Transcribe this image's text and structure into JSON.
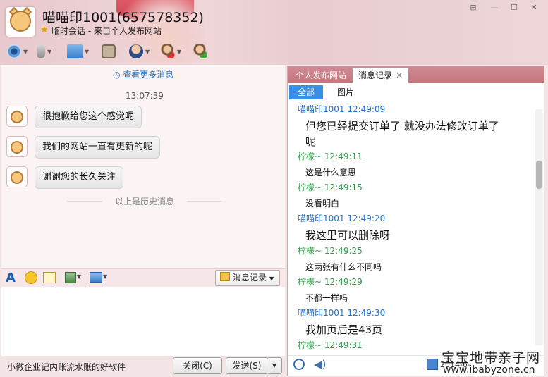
{
  "window": {
    "title": "喵喵印1001(657578352)",
    "subtitle": "临时会话 - 来自个人发布网站",
    "controls": [
      "⊟",
      "—",
      "☐",
      "✕"
    ]
  },
  "toolbar": {
    "icons": [
      "camera-icon",
      "microphone-icon",
      "file-transfer-icon",
      "screen-share-icon",
      "user-avatar-icon",
      "remove-user-icon",
      "add-user-icon"
    ]
  },
  "chat": {
    "more_messages": "查看更多消息",
    "timestamp": "13:07:39",
    "messages": [
      "很抱歉给您这个感觉呢",
      "我们的网站一直有更新的呢",
      "谢谢您的长久关注"
    ],
    "history_divider": "以上是历史消息"
  },
  "input_toolbar": {
    "message_record_label": "消息记录"
  },
  "bottom": {
    "ad_text": "小微企业记内账流水账的好软件",
    "close_label": "关闭(C)",
    "send_label": "发送(S)"
  },
  "right_panel": {
    "tabs": [
      "个人发布网站",
      "消息记录"
    ],
    "filters": [
      "全部",
      "图片"
    ],
    "history": [
      {
        "name": "喵喵印1001 12:49:09",
        "color": "blue",
        "text": "但您已经提交订单了 就没办法修改订单了",
        "text2": "呢",
        "size": "big"
      },
      {
        "name": "柠檬~ 12:49:11",
        "color": "green",
        "text": "这是什么意思",
        "size": "small"
      },
      {
        "name": "柠檬~ 12:49:15",
        "color": "green",
        "text": "没看明白",
        "size": "small"
      },
      {
        "name": "喵喵印1001 12:49:20",
        "color": "blue",
        "text": "我这里可以删除呀",
        "size": "big"
      },
      {
        "name": "柠檬~ 12:49:25",
        "color": "green",
        "text": "这两张有什么不同吗",
        "size": "small"
      },
      {
        "name": "柠檬~ 12:49:29",
        "color": "green",
        "text": "不都一样吗",
        "size": "small"
      },
      {
        "name": "喵喵印1001 12:49:30",
        "color": "blue",
        "text": "我加页后是43页",
        "size": "big"
      },
      {
        "name": "柠檬~ 12:49:31",
        "color": "green",
        "text": "",
        "size": "small"
      }
    ],
    "date_partial": "2014-6-"
  },
  "watermark": {
    "line1": "宝宝地带亲子网",
    "line2": "www.ibabyzone.cn"
  }
}
